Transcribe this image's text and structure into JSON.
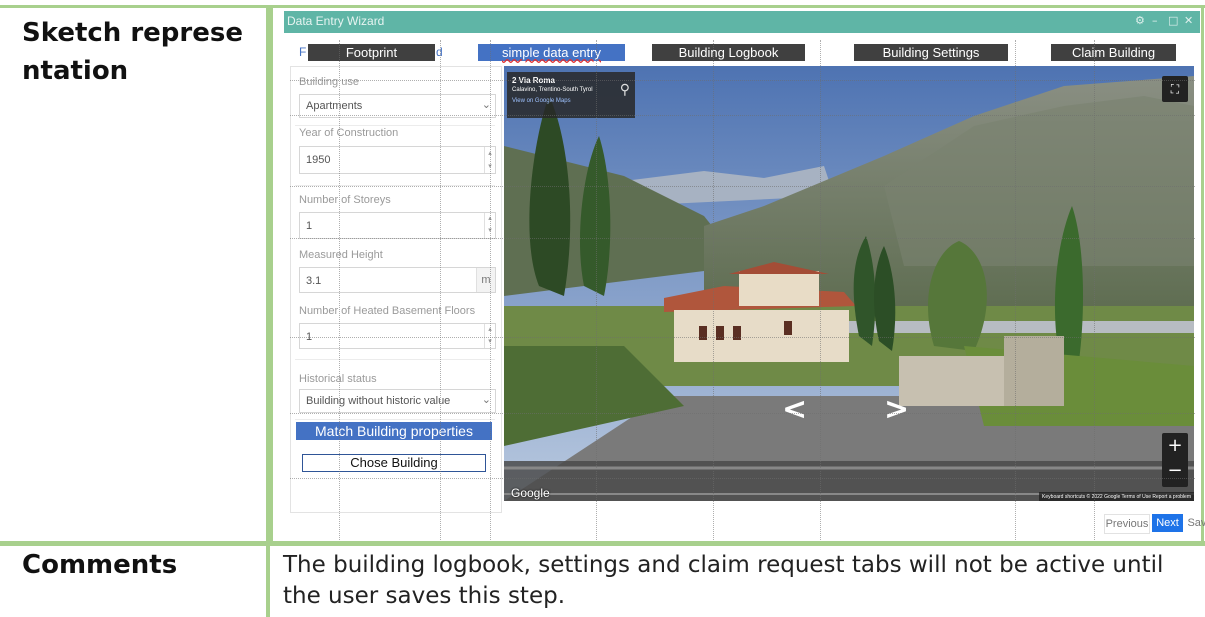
{
  "sketch_label": "Sketch representation",
  "comments_label": "Comments",
  "comment_text": "The building logbook, settings and claim request tabs will not be active until the user saves this step.",
  "wizard": {
    "title": "Data Entry Wizard",
    "window_controls": [
      "⚙",
      "–",
      "□",
      "✕"
    ],
    "tabs": {
      "footprint": "Footprint",
      "footprint_ghost_left": "F",
      "footprint_ghost_right": "d",
      "simple_data_entry": "simple data entry",
      "building_logbook": "Building Logbook",
      "building_settings": "Building Settings",
      "claim_building": "Claim Building"
    },
    "form": {
      "building_use_label": "Building use",
      "building_use_value": "Apartments",
      "year_label": "Year of Construction",
      "year_value": "1950",
      "storeys_label": "Number of Storeys",
      "storeys_value": "1",
      "height_label": "Measured Height",
      "height_value": "3.1",
      "height_unit": "m",
      "basement_label": "Number of Heated Basement Floors",
      "basement_value": "1",
      "historical_label": "Historical status",
      "historical_value": "Building without historic value"
    },
    "buttons": {
      "match": "Match Building properties",
      "chose": "Chose Building",
      "previous": "Previous",
      "next": "Next",
      "save": "Save"
    },
    "street_view": {
      "address_line1": "2 Via Roma",
      "address_line2": "Calavino, Trentino-South Tyrol",
      "maps_link": "View on Google Maps",
      "google": "Google",
      "attribution": "Keyboard shortcuts   © 2022 Google   Terms of Use   Report a problem",
      "fullscreen_icon": "fullscreen-icon",
      "pin_icon": "map-pin-icon"
    }
  },
  "colors": {
    "table_border": "#a8d08d",
    "titlebar": "#5fb5a6",
    "tab_dark": "#404040",
    "tab_blue": "#4472c4",
    "next_button": "#1e73e8"
  }
}
